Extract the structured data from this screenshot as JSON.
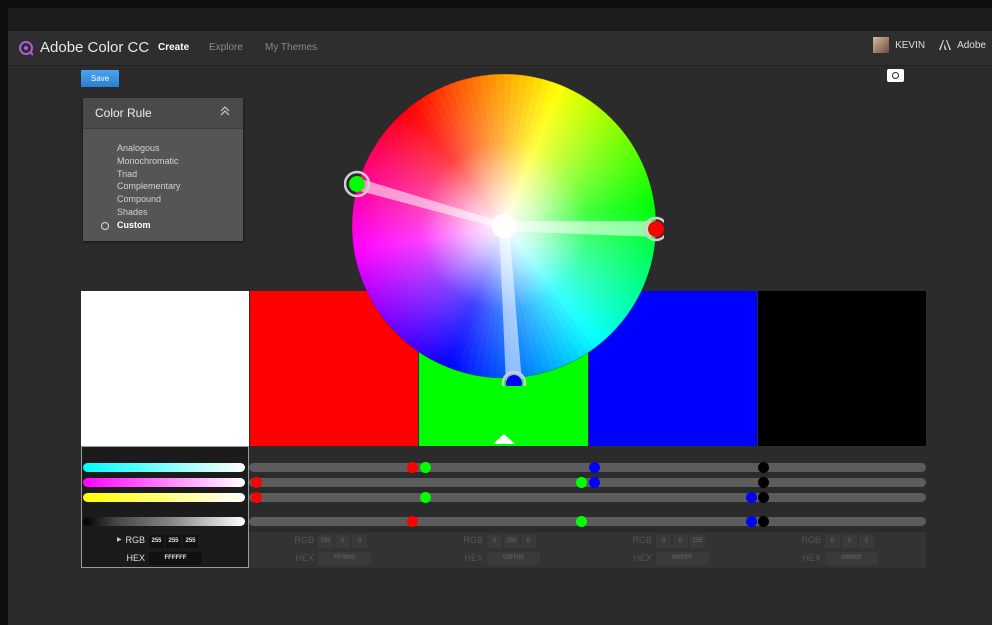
{
  "app": {
    "title": "Adobe Color CC"
  },
  "nav": {
    "create": "Create",
    "explore": "Explore",
    "my_themes": "My Themes"
  },
  "user": {
    "name": "KEVIN",
    "adobe": "Adobe"
  },
  "toolbar": {
    "save_label": "Save",
    "camera_icon": "camera-icon"
  },
  "color_rule": {
    "title": "Color Rule",
    "items": [
      "Analogous",
      "Monochromatic",
      "Triad",
      "Complementary",
      "Compound",
      "Shades",
      "Custom"
    ],
    "selected": "Custom"
  },
  "swatches": [
    {
      "color": "#FFFFFF",
      "rgb": [
        "255",
        "255",
        "255"
      ],
      "hex": "FFFFFF"
    },
    {
      "color": "#FF0000",
      "rgb": [
        "255",
        "0",
        "0"
      ],
      "hex": "FF0000"
    },
    {
      "color": "#00FF00",
      "rgb": [
        "0",
        "255",
        "0"
      ],
      "hex": "00FF00"
    },
    {
      "color": "#0000FF",
      "rgb": [
        "0",
        "0",
        "255"
      ],
      "hex": "0000FF"
    },
    {
      "color": "#000000",
      "rgb": [
        "0",
        "0",
        "0"
      ],
      "hex": "000000"
    }
  ],
  "base_swatch_index": 2,
  "labels": {
    "rgb": "RGB",
    "hex": "HEX"
  },
  "icons": {
    "collapse": "chevron-up-icon",
    "selected_radio": "radio-icon",
    "expand": "caret-right-icon"
  }
}
